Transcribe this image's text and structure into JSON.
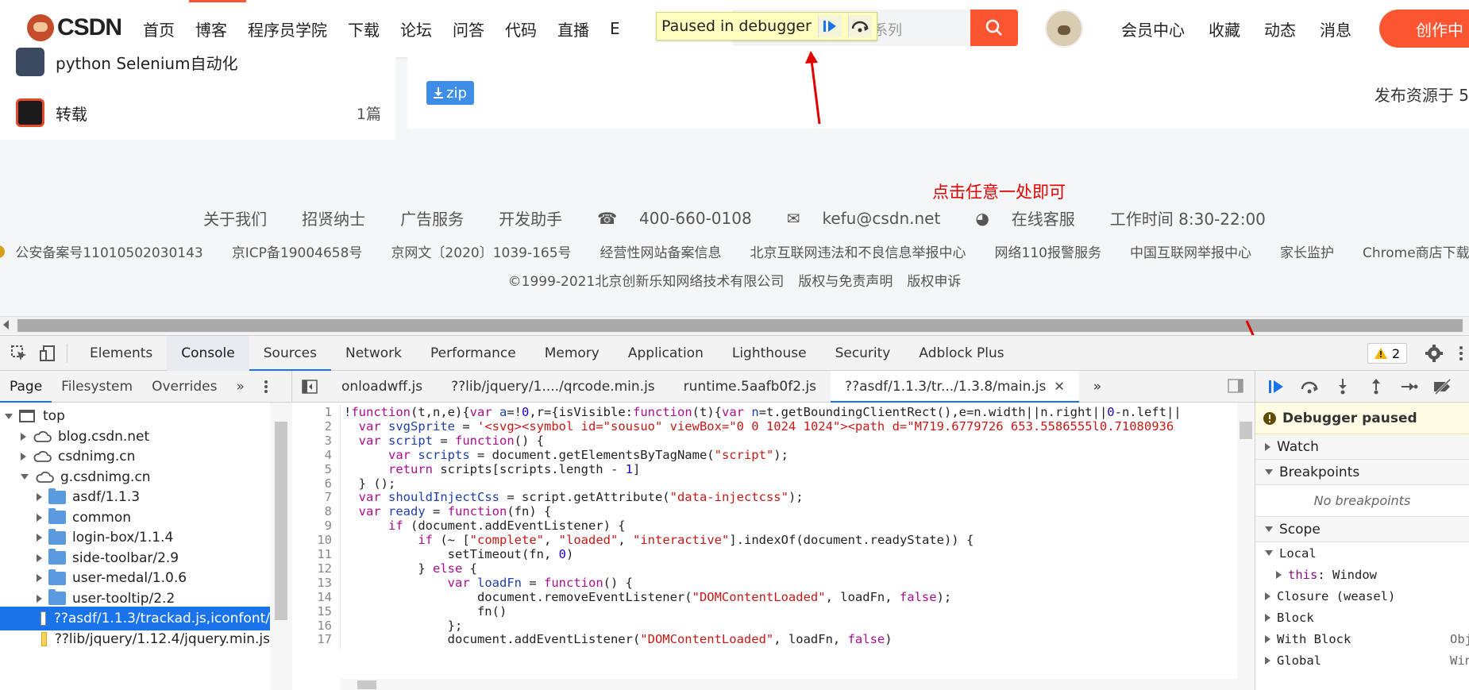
{
  "site": {
    "logo_text": "CSDN",
    "nav_items": [
      "首页",
      "博客",
      "程序员学院",
      "下载",
      "论坛",
      "问答",
      "代码",
      "直播",
      "E"
    ],
    "search_placeholder": "学系列",
    "debugger_banner": "Paused in debugger",
    "nav_right": [
      "会员中心",
      "收藏",
      "动态",
      "消息"
    ],
    "create_button": "创作中",
    "left_list": [
      {
        "label": "python Selenium自动化",
        "count": ""
      },
      {
        "label": "转载",
        "count": "1篇"
      }
    ],
    "zip_badge": "zip",
    "publish_text": "发布资源于 5",
    "annotation": "点击任意一处即可",
    "footer_row1": [
      "关于我们",
      "招贤纳士",
      "广告服务",
      "开发助手",
      "400-660-0108",
      "kefu@csdn.net",
      "在线客服",
      "工作时间 8:30-22:00"
    ],
    "footer_row2": [
      "公安备案号11010502030143",
      "京ICP备19004658号",
      "京网文〔2020〕1039-165号",
      "经营性网站备案信息",
      "北京互联网违法和不良信息举报中心",
      "网络110报警服务",
      "中国互联网举报中心",
      "家长监护",
      "Chrome商店下载"
    ],
    "footer_row3": [
      "©1999-2021北京创新乐知网络技术有限公司",
      "版权与免责声明",
      "版权申诉"
    ]
  },
  "devtools": {
    "tabs": [
      "Elements",
      "Console",
      "Sources",
      "Network",
      "Performance",
      "Memory",
      "Application",
      "Lighthouse",
      "Security",
      "Adblock Plus"
    ],
    "warning_count": "2",
    "nav_tabs": [
      "Page",
      "Filesystem",
      "Overrides"
    ],
    "tree": [
      {
        "label": "top",
        "depth": 0,
        "type": "frame",
        "expanded": true
      },
      {
        "label": "blog.csdn.net",
        "depth": 1,
        "type": "cloud",
        "expanded": false
      },
      {
        "label": "csdnimg.cn",
        "depth": 1,
        "type": "cloud",
        "expanded": false
      },
      {
        "label": "g.csdnimg.cn",
        "depth": 1,
        "type": "cloud",
        "expanded": true
      },
      {
        "label": "asdf/1.1.3",
        "depth": 2,
        "type": "folder",
        "expanded": false
      },
      {
        "label": "common",
        "depth": 2,
        "type": "folder",
        "expanded": false
      },
      {
        "label": "login-box/1.1.4",
        "depth": 2,
        "type": "folder",
        "expanded": false
      },
      {
        "label": "side-toolbar/2.9",
        "depth": 2,
        "type": "folder",
        "expanded": false
      },
      {
        "label": "user-medal/1.0.6",
        "depth": 2,
        "type": "folder",
        "expanded": false
      },
      {
        "label": "user-tooltip/2.2",
        "depth": 2,
        "type": "folder",
        "expanded": false
      },
      {
        "label": "??asdf/1.1.3/trackad.js,iconfont/",
        "depth": 2,
        "type": "file",
        "selected": true
      },
      {
        "label": "??lib/jquery/1.12.4/jquery.min.js",
        "depth": 2,
        "type": "file-yellow"
      }
    ],
    "editor_tabs": [
      {
        "label": "onloadwff.js",
        "active": false
      },
      {
        "label": "??lib/jquery/1..../qrcode.min.js",
        "active": false
      },
      {
        "label": "runtime.5aafb0f2.js",
        "active": false
      },
      {
        "label": "??asdf/1.1.3/tr.../1.3.8/main.js",
        "active": true
      }
    ],
    "code_lines": [
      "!function(t,n,e){var a=!0,r={isVisible:function(t){var n=t.getBoundingClientRect(),e=n.width||n.right||0-n.left||",
      "  var svgSprite = '<svg><symbol id=\"sousuo\" viewBox=\"0 0 1024 1024\"><path d=\"M719.6779726 653.5586555l0.71080936",
      "  var script = function() {",
      "      var scripts = document.getElementsByTagName(\"script\");",
      "      return scripts[scripts.length - 1]",
      "  } ();",
      "  var shouldInjectCss = script.getAttribute(\"data-injectcss\");",
      "  var ready = function(fn) {",
      "      if (document.addEventListener) {",
      "          if (~ [\"complete\", \"loaded\", \"interactive\"].indexOf(document.readyState)) {",
      "              setTimeout(fn, 0)",
      "          } else {",
      "              var loadFn = function() {",
      "                  document.removeEventListener(\"DOMContentLoaded\", loadFn, false);",
      "                  fn()",
      "              };",
      "              document.addEventListener(\"DOMContentLoaded\", loadFn, false)"
    ],
    "sidebar": {
      "paused_message": "Debugger paused",
      "watch": "Watch",
      "breakpoints": "Breakpoints",
      "no_breakpoints": "No breakpoints",
      "scope": "Scope",
      "scope_items": [
        {
          "label": "Local",
          "expanded": true,
          "depth": 0,
          "side": ""
        },
        {
          "label": "this: Window",
          "expanded": false,
          "depth": 1,
          "side": ""
        },
        {
          "label": "Closure (weasel)",
          "expanded": false,
          "depth": 0,
          "side": ""
        },
        {
          "label": "Block",
          "expanded": false,
          "depth": 0,
          "side": ""
        },
        {
          "label": "With Block",
          "expanded": false,
          "depth": 0,
          "side": "Obj"
        },
        {
          "label": "Global",
          "expanded": false,
          "depth": 0,
          "side": "Win"
        }
      ]
    }
  },
  "colors": {
    "accent": "#fc5531",
    "devtools_blue": "#1a73e8",
    "annotation": "#e10000"
  }
}
